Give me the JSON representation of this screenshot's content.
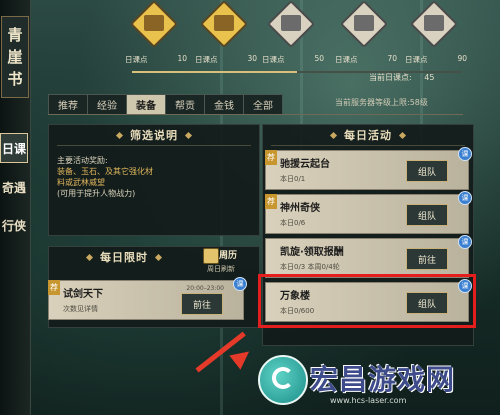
{
  "sidebar": {
    "title_chars": [
      "青",
      "崖",
      "书"
    ],
    "tabs": [
      {
        "label": "日课",
        "active": true
      },
      {
        "label": "奇遇",
        "active": false
      },
      {
        "label": "行侠",
        "active": false
      }
    ]
  },
  "rewards": {
    "items": [
      {
        "label": "日课点",
        "points": "10",
        "chest": "gold"
      },
      {
        "label": "日课点",
        "points": "30",
        "chest": "gold"
      },
      {
        "label": "日课点",
        "points": "50",
        "chest": "silver"
      },
      {
        "label": "日课点",
        "points": "70",
        "chest": "silver"
      },
      {
        "label": "日课点",
        "points": "90",
        "chest": "silver"
      }
    ],
    "current_label": "当前日课点:",
    "current_value": "45",
    "progress_fraction": 0.5
  },
  "tabs": {
    "items": [
      {
        "label": "推荐",
        "active": false
      },
      {
        "label": "经验",
        "active": false
      },
      {
        "label": "装备",
        "active": true
      },
      {
        "label": "帮贡",
        "active": false
      },
      {
        "label": "金钱",
        "active": false
      },
      {
        "label": "全部",
        "active": false
      }
    ],
    "server_level": "当前服务器等级上限:58级"
  },
  "filter_panel": {
    "title": "筛选说明",
    "line1": "主要活动奖励:",
    "line2": "装备、玉石、及其它强化材",
    "line3": "料或武林威望",
    "line4": "(可用于提升人物战力)"
  },
  "limited_panel": {
    "title": "每日限时",
    "calendar_label": "周历",
    "calendar_sub": "周日刷新",
    "activity": {
      "badge": "荐",
      "name": "试剑天下",
      "info": "次数见详情",
      "time": "20:00–23:00",
      "button": "前往",
      "ke": "课"
    }
  },
  "daily_panel": {
    "title": "每日活动",
    "activities": [
      {
        "badge": "荐",
        "name": "驰援云起台",
        "info": "本日0/1",
        "button": "组队",
        "ke": "课"
      },
      {
        "badge": "荐",
        "name": "神州奇侠",
        "info": "本日0/6",
        "button": "组队",
        "ke": "课"
      },
      {
        "badge": "",
        "name": "凯旋·领取报酬",
        "info": "本日0/3  本周0/4轮",
        "button": "前往",
        "ke": "课"
      },
      {
        "badge": "",
        "name": "万象楼",
        "info": "本日0/600",
        "button": "组队",
        "ke": "课"
      }
    ]
  },
  "watermark": {
    "title": "宏昌游戏网",
    "url": "www.hcs-laser.com"
  }
}
